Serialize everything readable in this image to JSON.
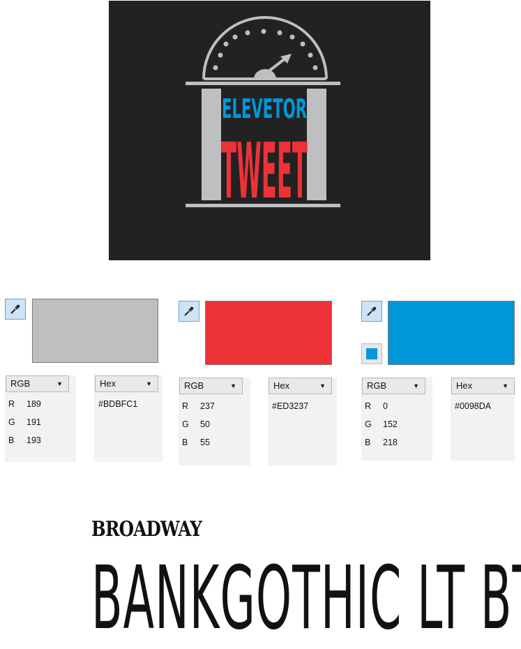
{
  "logo": {
    "word_top": "ELEVETOR",
    "word_bottom": "TWEET",
    "colors": {
      "background": "#222222",
      "gray": "#BDBFC1",
      "red": "#ED3237",
      "blue": "#0098DA"
    }
  },
  "pickers": [
    {
      "swatch_color": "#BDBFC1",
      "mode": "RGB",
      "format": "Hex",
      "channels": [
        {
          "label": "R",
          "value": "189"
        },
        {
          "label": "G",
          "value": "191"
        },
        {
          "label": "B",
          "value": "193"
        }
      ],
      "hex": "#BDBFC1"
    },
    {
      "swatch_color": "#ED3237",
      "mode": "RGB",
      "format": "Hex",
      "channels": [
        {
          "label": "R",
          "value": "237"
        },
        {
          "label": "G",
          "value": "50"
        },
        {
          "label": "B",
          "value": "55"
        }
      ],
      "hex": "#ED3237"
    },
    {
      "swatch_color": "#0098DA",
      "mode": "RGB",
      "format": "Hex",
      "channels": [
        {
          "label": "R",
          "value": "0"
        },
        {
          "label": "G",
          "value": "152"
        },
        {
          "label": "B",
          "value": "218"
        }
      ],
      "hex": "#0098DA"
    }
  ],
  "icons": {
    "eyedropper": "eyedropper-icon",
    "dropdown": "chevron-down-icon"
  },
  "fonts": {
    "line1": "BROADWAY",
    "line2": "BANKGOTHIC LT BT"
  }
}
